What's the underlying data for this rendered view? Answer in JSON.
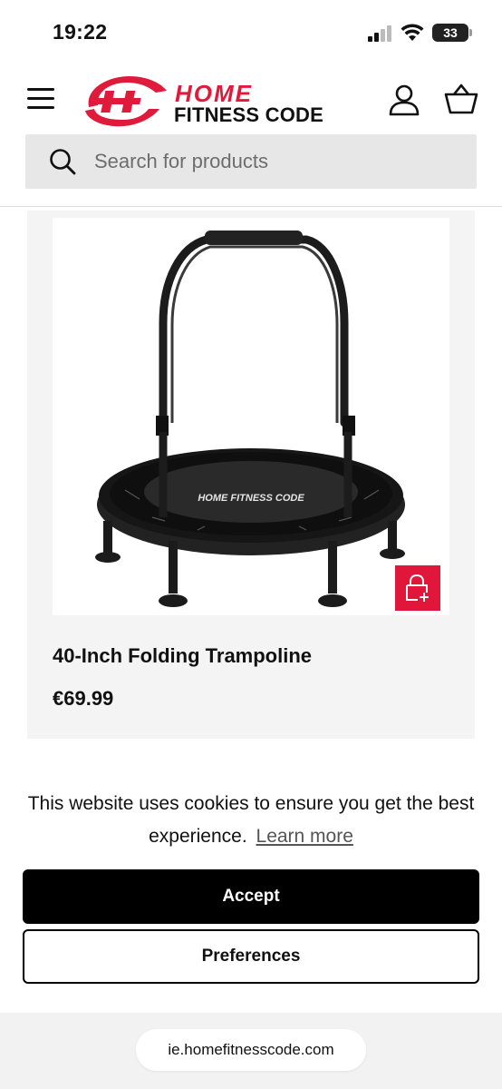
{
  "status_bar": {
    "time": "19:22",
    "battery": "33",
    "icons": [
      "cellular-signal-icon",
      "wifi-icon",
      "battery-icon"
    ]
  },
  "header": {
    "menu_icon": "hamburger-menu-icon",
    "logo": {
      "line1": "HOME",
      "line2": "FITNESS CODE"
    },
    "account_icon": "user-icon",
    "basket_icon": "basket-icon",
    "search": {
      "placeholder": "Search for products",
      "value": ""
    }
  },
  "product": {
    "title": "40-Inch Folding Trampoline",
    "price": "€69.99",
    "image_alt": "trampoline-image",
    "quick_add_icon": "lock-plus-icon"
  },
  "cookie_banner": {
    "message": "This website uses cookies to ensure you get the best experience.",
    "learn_more": "Learn more",
    "accept_label": "Accept",
    "preferences_label": "Preferences"
  },
  "browser": {
    "url": "ie.homefitnesscode.com"
  },
  "colors": {
    "brand_red": "#e01a3b",
    "accept_bg": "#000000",
    "search_bg": "#e7e7e7",
    "card_bg": "#f4f4f4"
  }
}
